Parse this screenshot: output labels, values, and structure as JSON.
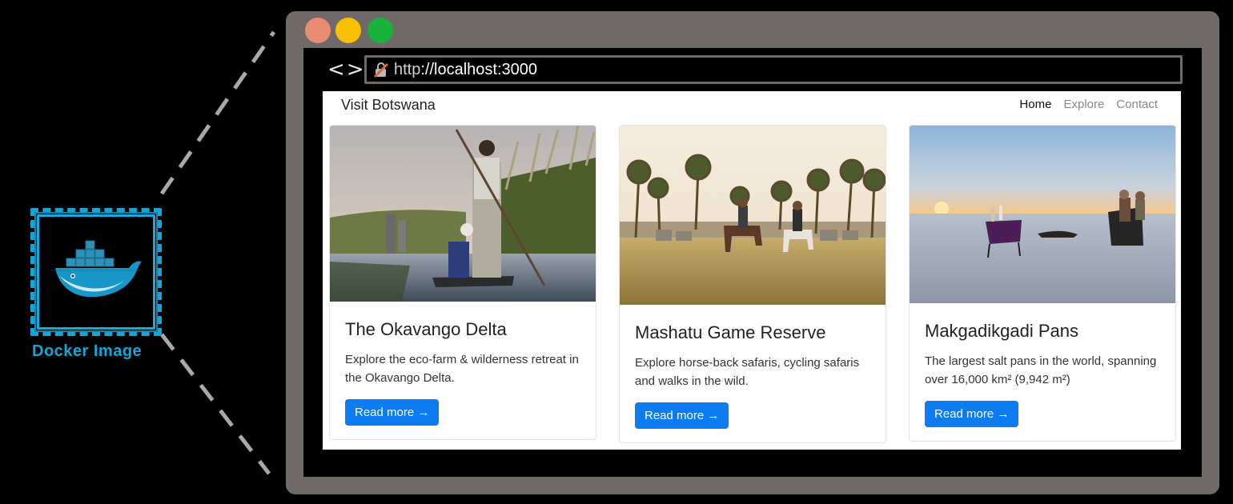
{
  "docker": {
    "caption": "Docker Image",
    "icon": "docker-whale-icon",
    "accent": "#14a6d6"
  },
  "browser": {
    "url_protocol": "http",
    "url_rest": "://localhost:3000",
    "back_icon": "<",
    "forward_icon": ">",
    "frame_color": "#6f6a68",
    "traffic_lights": [
      "#ea8c72",
      "#f7c003",
      "#17b33b"
    ]
  },
  "site": {
    "brand": "Visit Botswana",
    "nav": [
      {
        "label": "Home"
      },
      {
        "label": "Explore"
      },
      {
        "label": "Contact"
      }
    ]
  },
  "cards": [
    {
      "title": "The Okavango Delta",
      "text": "Explore the eco-farm & wilderness retreat in the Okavango Delta.",
      "button": "Read more →"
    },
    {
      "title": "Mashatu Game Reserve",
      "text": "Explore horse-back safaris, cycling safaris and walks in the wild.",
      "button": "Read more →"
    },
    {
      "title": "Makgadikgadi Pans",
      "text": "The largest salt pans in the world, spanning over 16,000 km² (9,942 m²)",
      "button": "Read more →"
    }
  ]
}
